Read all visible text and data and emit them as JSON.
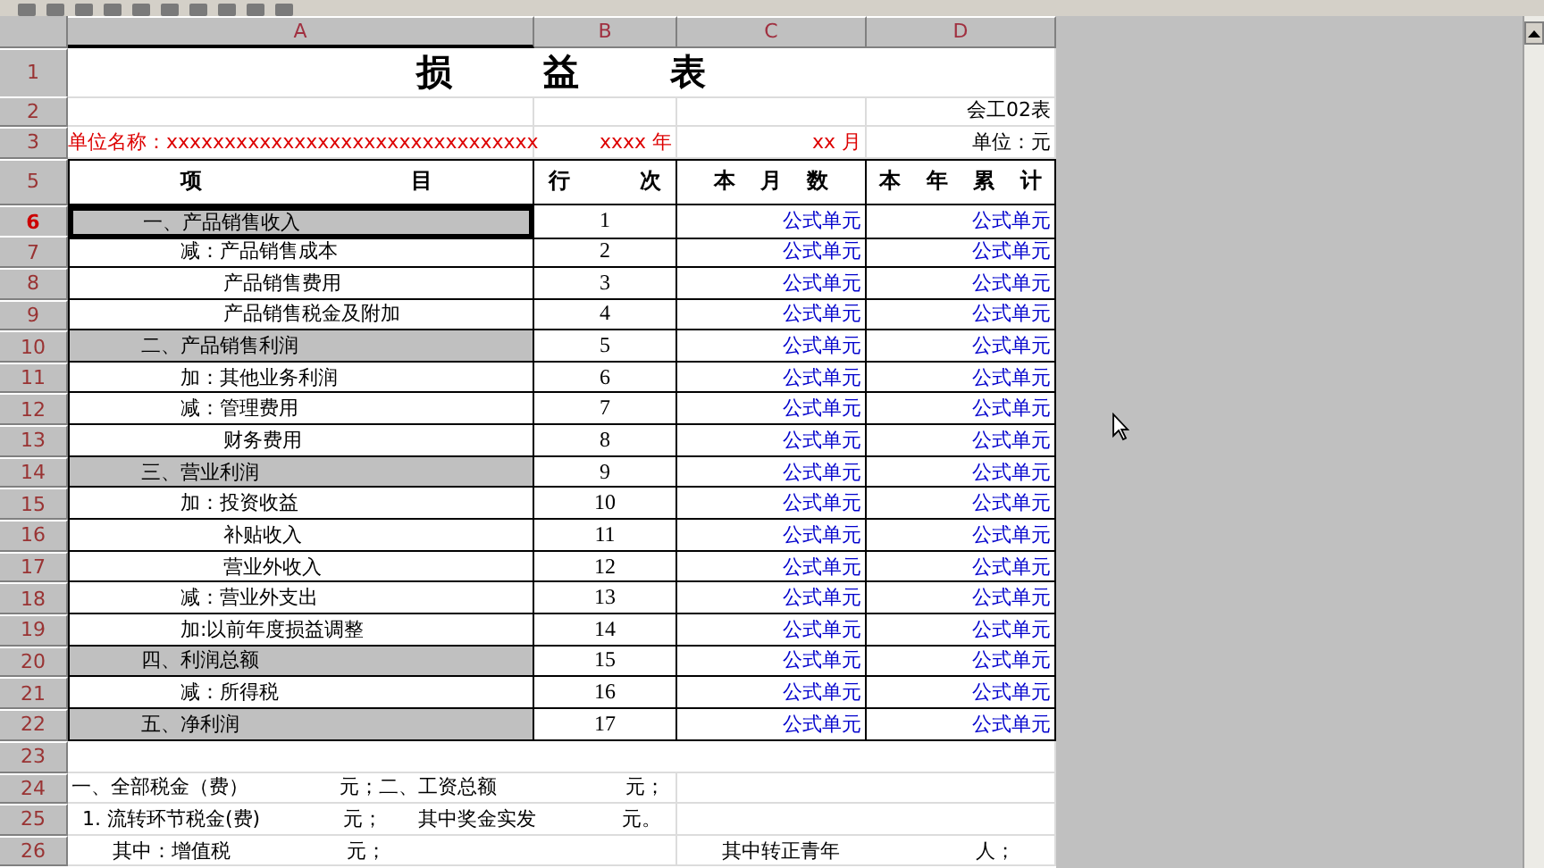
{
  "columns": [
    {
      "label": "A",
      "selected": true
    },
    {
      "label": "B",
      "selected": false
    },
    {
      "label": "C",
      "selected": false
    },
    {
      "label": "D",
      "selected": false
    }
  ],
  "title_row": {
    "row_header": "1",
    "title": "损 益 表"
  },
  "form_row": {
    "row_header": "2",
    "form_no": "会工02表"
  },
  "unit_row": {
    "row_header": "3",
    "company_label": "单位名称：",
    "company_value": "xxxxxxxxxxxxxxxxxxxxxxxxxxxxxxxx",
    "year": "xxxx 年",
    "month": "xx 月",
    "unit": "单位：元"
  },
  "header_row": {
    "row_header": "5",
    "item_start": "项",
    "item_end": "目",
    "line_start": "行",
    "line_end": "次",
    "month": "本 月 数",
    "year": "本 年 累 计"
  },
  "items": [
    {
      "row_header": "6",
      "item": "一、产品销售收入",
      "line_no": "1",
      "month": "公式单元",
      "year": "公式单元",
      "selected": true,
      "children": [
        {
          "row_header": "7",
          "item": "减：产品销售成本",
          "line_no": "2",
          "month": "公式单元",
          "year": "公式单元",
          "selected": false,
          "children": [
            {
              "row_header": "8",
              "item": "产品销售费用",
              "line_no": "3",
              "month": "公式单元",
              "year": "公式单元",
              "selected": false
            },
            {
              "row_header": "9",
              "item": "产品销售税金及附加",
              "line_no": "4",
              "month": "公式单元",
              "year": "公式单元",
              "selected": false
            }
          ]
        }
      ]
    },
    {
      "row_header": "10",
      "item": "二、产品销售利润",
      "line_no": "5",
      "month": "公式单元",
      "year": "公式单元",
      "selected": false,
      "children": [
        {
          "row_header": "11",
          "item": "加：其他业务利润",
          "line_no": "6",
          "month": "公式单元",
          "year": "公式单元",
          "selected": false
        },
        {
          "row_header": "12",
          "item": "减：管理费用",
          "line_no": "7",
          "month": "公式单元",
          "year": "公式单元",
          "selected": false,
          "children": [
            {
              "row_header": "13",
              "item": "财务费用",
              "line_no": "8",
              "month": "公式单元",
              "year": "公式单元",
              "selected": false
            }
          ]
        }
      ]
    },
    {
      "row_header": "14",
      "item": "三、营业利润",
      "line_no": "9",
      "month": "公式单元",
      "year": "公式单元",
      "selected": false,
      "children": [
        {
          "row_header": "15",
          "item": "加：投资收益",
          "line_no": "10",
          "month": "公式单元",
          "year": "公式单元",
          "selected": false,
          "children": [
            {
              "row_header": "16",
              "item": "补贴收入",
              "line_no": "11",
              "month": "公式单元",
              "year": "公式单元",
              "selected": false
            },
            {
              "row_header": "17",
              "item": "营业外收入",
              "line_no": "12",
              "month": "公式单元",
              "year": "公式单元",
              "selected": false
            }
          ]
        },
        {
          "row_header": "18",
          "item": "减：营业外支出",
          "line_no": "13",
          "month": "公式单元",
          "year": "公式单元",
          "selected": false
        },
        {
          "row_header": "19",
          "item": "加:以前年度损益调整",
          "line_no": "14",
          "month": "公式单元",
          "year": "公式单元",
          "selected": false
        }
      ]
    },
    {
      "row_header": "20",
      "item": "四、利润总额",
      "line_no": "15",
      "month": "公式单元",
      "year": "公式单元",
      "selected": false,
      "children": [
        {
          "row_header": "21",
          "item": "减：所得税",
          "line_no": "16",
          "month": "公式单元",
          "year": "公式单元",
          "selected": false
        }
      ]
    },
    {
      "row_header": "22",
      "item": "五、净利润",
      "line_no": "17",
      "month": "公式单元",
      "year": "公式单元",
      "selected": false
    }
  ],
  "blank_row": {
    "row_header": "23"
  },
  "notes": [
    {
      "row_header": "24",
      "left": [
        "一、全部税金（费）",
        "元；二、工资总额",
        "元；"
      ]
    },
    {
      "row_header": "25",
      "left": [
        "1. 流转环节税金(费)",
        "元；",
        "其中奖金实发",
        "元。"
      ]
    },
    {
      "row_header": "26",
      "left": [
        "其中：增值税",
        "元；"
      ],
      "right": [
        "其中转正青年",
        "人；"
      ]
    }
  ]
}
